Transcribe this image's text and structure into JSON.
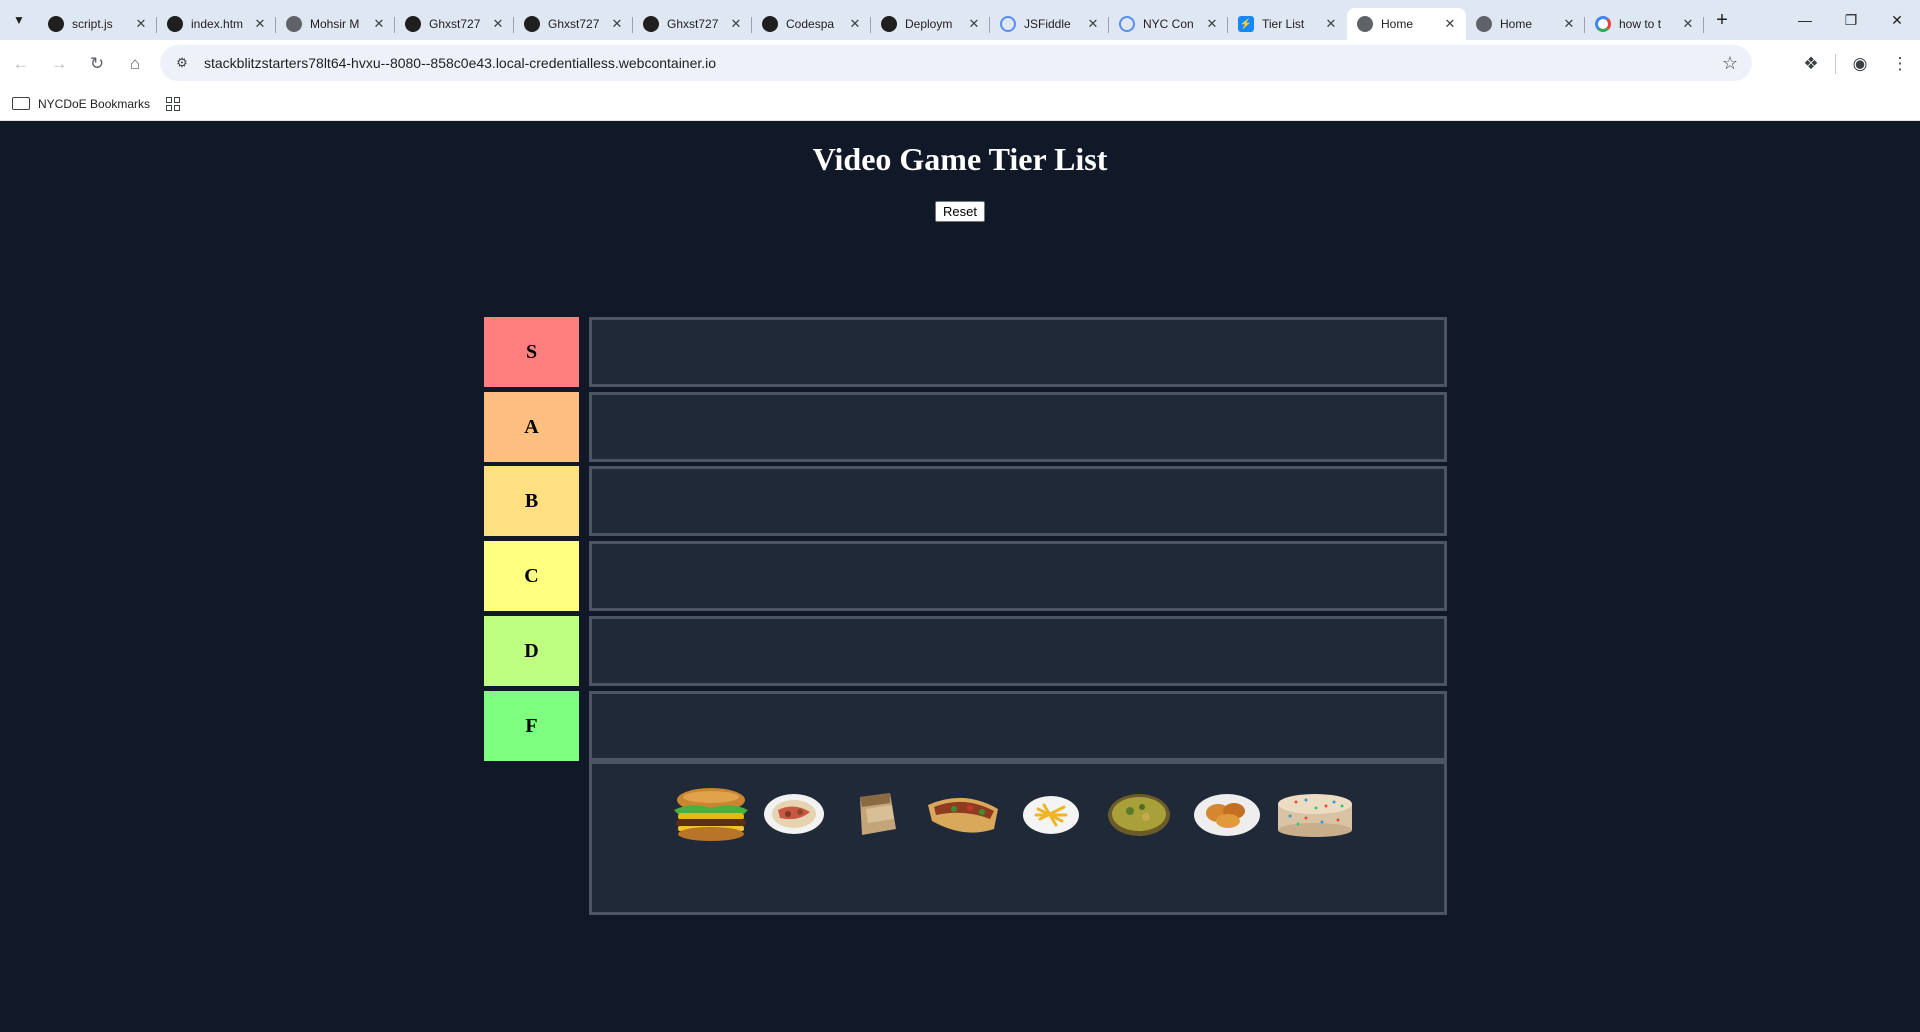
{
  "browser": {
    "tabs": [
      {
        "title": "script.js",
        "icon": "github-icon",
        "active": false
      },
      {
        "title": "index.htm",
        "icon": "github-icon",
        "active": false
      },
      {
        "title": "Mohsir M",
        "icon": "globe-icon",
        "active": false
      },
      {
        "title": "Ghxst727",
        "icon": "github-icon",
        "active": false
      },
      {
        "title": "Ghxst727",
        "icon": "github-icon",
        "active": false
      },
      {
        "title": "Ghxst727",
        "icon": "github-icon",
        "active": false
      },
      {
        "title": "Codespa",
        "icon": "github-icon",
        "active": false
      },
      {
        "title": "Deploym",
        "icon": "github-icon",
        "active": false
      },
      {
        "title": "JSFiddle",
        "icon": "cloud-icon",
        "active": false
      },
      {
        "title": "NYC Con",
        "icon": "cloud-icon",
        "active": false
      },
      {
        "title": "Tier List",
        "icon": "stackblitz-icon",
        "active": false
      },
      {
        "title": "Home",
        "icon": "globe-icon",
        "active": true
      },
      {
        "title": "Home",
        "icon": "globe-icon",
        "active": false
      },
      {
        "title": "how to t",
        "icon": "google-icon",
        "active": false
      }
    ],
    "url": "stackblitzstarters78lt64-hvxu--8080--858c0e43.local-credentialless.webcontainer.io",
    "bookmarks": {
      "folder_label": "NYCDoE Bookmarks"
    }
  },
  "page": {
    "title": "Video Game Tier List",
    "reset_label": "Reset",
    "tiers": [
      {
        "label": "S",
        "color": "#ff7f7f"
      },
      {
        "label": "A",
        "color": "#ffbf7f"
      },
      {
        "label": "B",
        "color": "#ffdf7f"
      },
      {
        "label": "C",
        "color": "#ffff7f"
      },
      {
        "label": "D",
        "color": "#bfff7f"
      },
      {
        "label": "F",
        "color": "#7fff7f"
      }
    ],
    "pool_items": [
      "burger-image",
      "rice-plate-image",
      "wrap-image",
      "shawarma-image",
      "fries-plate-image",
      "curry-bowl-image",
      "fried-chicken-image",
      "sprinkle-cake-image"
    ]
  }
}
